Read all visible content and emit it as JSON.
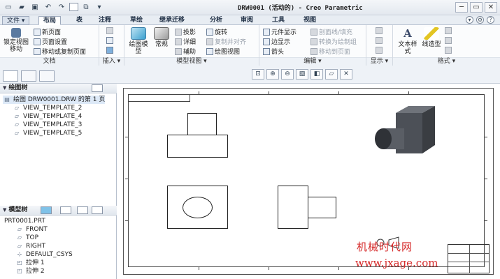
{
  "title_bar": {
    "text": "DRW0001 (活动的) - Creo Parametric"
  },
  "tabs": [
    {
      "label": "文件 ▾"
    },
    {
      "label": "布局"
    },
    {
      "label": "表"
    },
    {
      "label": "注释"
    },
    {
      "label": "草绘"
    },
    {
      "label": "继承迁移"
    },
    {
      "label": "分析"
    },
    {
      "label": "审阅"
    },
    {
      "label": "工具"
    },
    {
      "label": "视图"
    }
  ],
  "ribbon": {
    "doc_group": {
      "label": "文档",
      "lock_view": "锁定视图移动",
      "new_page": "新页面",
      "page_setup": "页面设置",
      "move_copy_page": "移动或复制页面"
    },
    "insert_group": {
      "label": "插入 ▾"
    },
    "model_view_group": {
      "label": "模型视图 ▾",
      "general_view": "绘图模型",
      "general": "常规",
      "projection": "投影",
      "detailed": "详细",
      "auxiliary": "辅助",
      "rotate": "旋转",
      "copy_align": "复制并对齐",
      "drawing_view": "绘图视图"
    },
    "edit_group": {
      "label": "编辑 ▾",
      "element_display": "元件显示",
      "edge_display": "边显示",
      "arrow": "箭头",
      "section_line": "剖面线/填充",
      "convert_to_draw": "转换为绘制组",
      "move_to_page": "移动到页面"
    },
    "display_group": {
      "label": "显示 ▾"
    },
    "format_group": {
      "label": "格式 ▾",
      "text_style": "文本样式",
      "line_style": "线造型"
    }
  },
  "view_toolbar": {
    "icons": [
      "zoom-fit-icon",
      "zoom-in-icon",
      "zoom-out-icon",
      "repaint-icon",
      "display-style-icon",
      "saved-views-icon",
      "datum-display-icon"
    ]
  },
  "drawing_tree": {
    "header": "绘图树",
    "items": [
      {
        "label": "绘图 DRW0001.DRW 的第 1 页",
        "icon": "drawing-icon"
      },
      {
        "label": "VIEW_TEMPLATE_2",
        "icon": "view-icon"
      },
      {
        "label": "VIEW_TEMPLATE_4",
        "icon": "view-icon"
      },
      {
        "label": "VIEW_TEMPLATE_3",
        "icon": "view-icon"
      },
      {
        "label": "VIEW_TEMPLATE_5",
        "icon": "view-icon"
      }
    ]
  },
  "model_tree": {
    "header": "模型树",
    "items": [
      {
        "label": "PRT0001.PRT",
        "icon": "part-icon"
      },
      {
        "label": "FRONT",
        "icon": "datum-plane-icon"
      },
      {
        "label": "TOP",
        "icon": "datum-plane-icon"
      },
      {
        "label": "RIGHT",
        "icon": "datum-plane-icon"
      },
      {
        "label": "DEFAULT_CSYS",
        "icon": "csys-icon"
      },
      {
        "label": "拉伸 1",
        "icon": "extrude-icon"
      },
      {
        "label": "拉伸 2",
        "icon": "extrude-icon"
      }
    ]
  },
  "watermark": {
    "line1": "机械时代网",
    "line2": "www.jxage.com"
  },
  "colors": {
    "accent": "#2a5ea8",
    "watermark": "#d62b2b",
    "ribbon_bg": "#fbfcfd"
  }
}
